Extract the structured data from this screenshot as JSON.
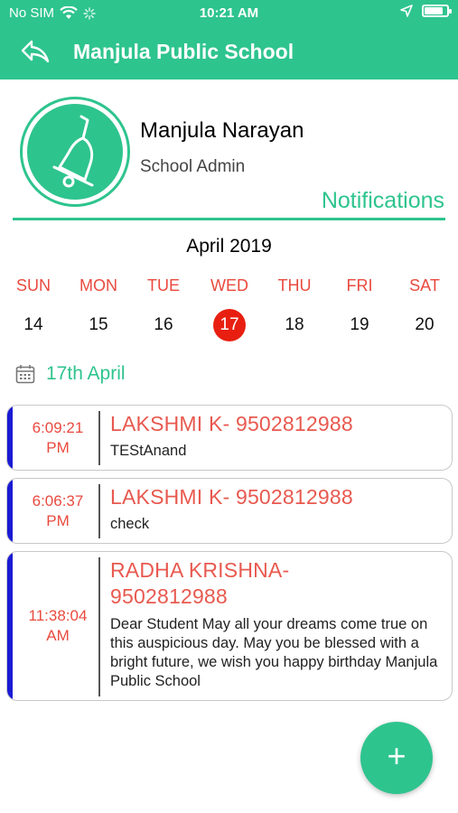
{
  "status_bar": {
    "carrier": "No SIM",
    "time": "10:21 AM",
    "battery_level": 0.85
  },
  "header": {
    "title": "Manjula Public School",
    "back_icon": "back-arrow-icon"
  },
  "profile": {
    "name": "Manjula Narayan",
    "role": "School Admin",
    "avatar_icon": "bell-icon"
  },
  "page_label": "Notifications",
  "calendar": {
    "month": "April 2019",
    "days": [
      {
        "name": "SUN",
        "num": "14"
      },
      {
        "name": "MON",
        "num": "15"
      },
      {
        "name": "TUE",
        "num": "16"
      },
      {
        "name": "WED",
        "num": "17"
      },
      {
        "name": "THU",
        "num": "18"
      },
      {
        "name": "FRI",
        "num": "19"
      },
      {
        "name": "SAT",
        "num": "20"
      }
    ],
    "selected_index": 3
  },
  "selected_date": "17th April",
  "notifications": [
    {
      "time_line1": "6:09:21",
      "time_line2": "PM",
      "title": "LAKSHMI K- 9502812988",
      "message": "TEStAnand"
    },
    {
      "time_line1": "6:06:37",
      "time_line2": "PM",
      "title": "LAKSHMI K- 9502812988",
      "message": "check"
    },
    {
      "time_line1": "11:38:04",
      "time_line2": "AM",
      "title": "RADHA KRISHNA- 9502812988",
      "message": "Dear Student May all your dreams come true on this auspicious day. May you be blessed with a bright future, we wish you happy birthday Manjula Public School"
    }
  ],
  "fab": {
    "label": "+"
  },
  "colors": {
    "accent": "#2ec48e",
    "day_name": "#e94a3f",
    "selected_day": "#e81f10",
    "card_bar": "#1a1ad4"
  }
}
